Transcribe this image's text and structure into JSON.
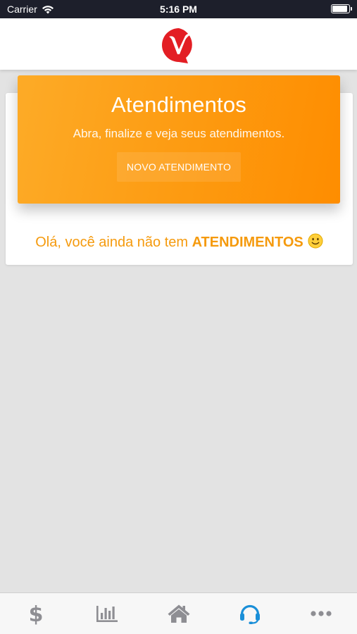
{
  "status_bar": {
    "carrier": "Carrier",
    "time": "5:16 PM",
    "wifi_icon": "wifi-icon",
    "battery_icon": "battery-icon"
  },
  "header": {
    "logo": "brand-logo-v",
    "logo_color": "#e31e24"
  },
  "banner": {
    "title": "Atendimentos",
    "subtitle": "Abra, finalize e veja seus atendimentos.",
    "button_label": "NOVO ATENDIMENTO",
    "gradient_start": "#fdab27",
    "gradient_end": "#fe8d00"
  },
  "empty_state": {
    "prefix": "Olá, você ainda não tem ",
    "emphasis": "ATENDIMENTOS",
    "emoji_icon": "smiley-face-icon",
    "color": "#f59a0d"
  },
  "tab_bar": {
    "items": [
      {
        "icon": "dollar-icon",
        "active": false
      },
      {
        "icon": "bar-chart-icon",
        "active": false
      },
      {
        "icon": "home-icon",
        "active": false
      },
      {
        "icon": "headset-icon",
        "active": true
      },
      {
        "icon": "more-dots-icon",
        "active": false
      }
    ],
    "active_color": "#1a8fd8",
    "inactive_color": "#8e8e93"
  }
}
